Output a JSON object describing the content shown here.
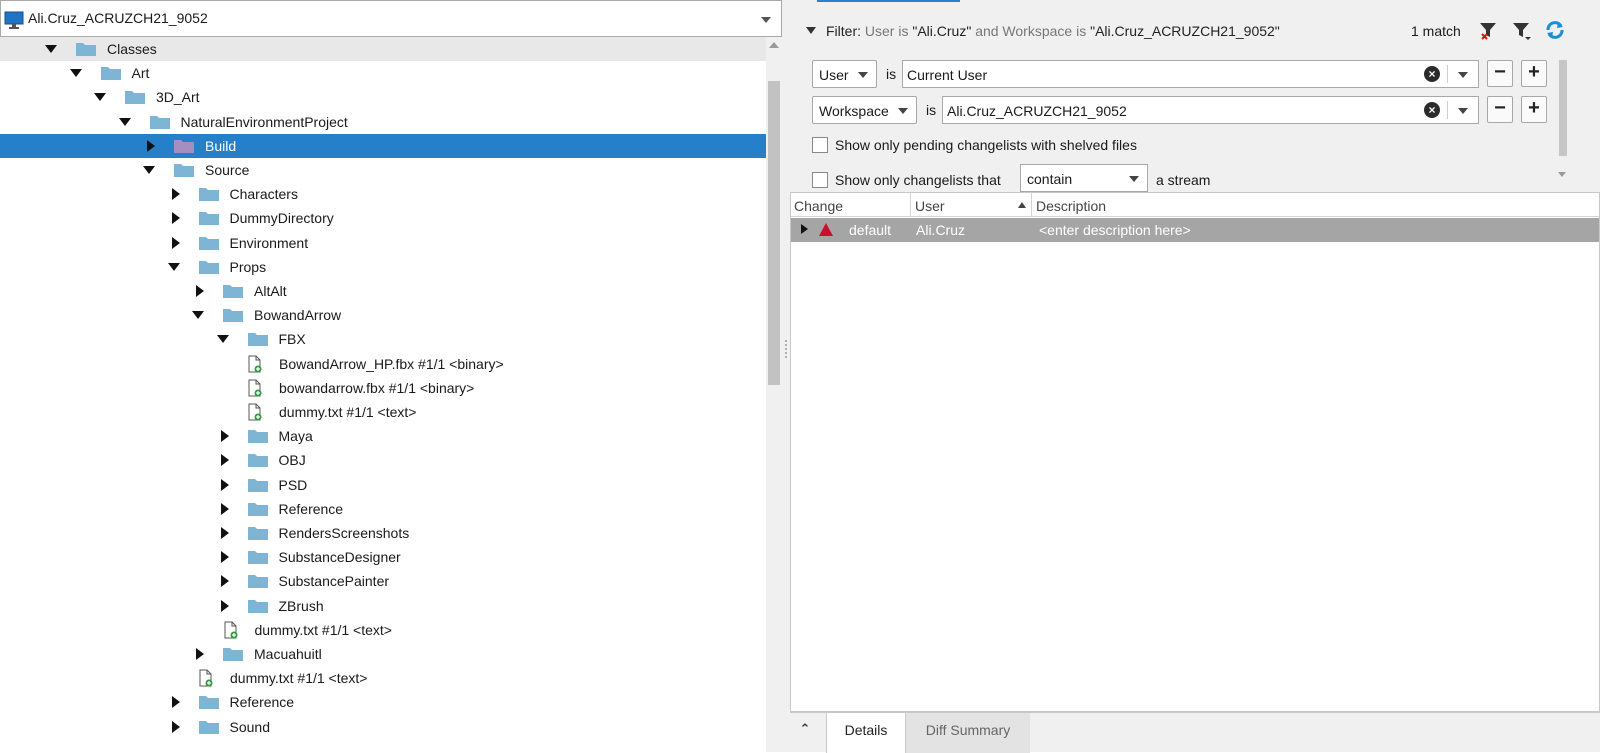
{
  "workspace_selector": {
    "label": "Ali.Cruz_ACRUZCH21_9052"
  },
  "tree": {
    "rows": [
      {
        "label": "Classes",
        "type": "folder",
        "state": "open"
      },
      {
        "label": "Art",
        "type": "folder",
        "state": "open"
      },
      {
        "label": "3D_Art",
        "type": "folder",
        "state": "open"
      },
      {
        "label": "NaturalEnvironmentProject",
        "type": "folder",
        "state": "open"
      },
      {
        "label": "Build",
        "type": "folder",
        "state": "closed",
        "selected": true
      },
      {
        "label": "Source",
        "type": "folder",
        "state": "open"
      },
      {
        "label": "Characters",
        "type": "folder",
        "state": "closed"
      },
      {
        "label": "DummyDirectory",
        "type": "folder",
        "state": "closed"
      },
      {
        "label": "Environment",
        "type": "folder",
        "state": "closed"
      },
      {
        "label": "Props",
        "type": "folder",
        "state": "open"
      },
      {
        "label": "AltAlt",
        "type": "folder",
        "state": "closed"
      },
      {
        "label": "BowandArrow",
        "type": "folder",
        "state": "open"
      },
      {
        "label": "FBX",
        "type": "folder",
        "state": "open"
      },
      {
        "label": "BowandArrow_HP.fbx #1/1 <binary>",
        "type": "file"
      },
      {
        "label": "bowandarrow.fbx #1/1 <binary>",
        "type": "file"
      },
      {
        "label": "dummy.txt #1/1 <text>",
        "type": "file"
      },
      {
        "label": "Maya",
        "type": "folder",
        "state": "closed"
      },
      {
        "label": "OBJ",
        "type": "folder",
        "state": "closed"
      },
      {
        "label": "PSD",
        "type": "folder",
        "state": "closed"
      },
      {
        "label": "Reference",
        "type": "folder",
        "state": "closed"
      },
      {
        "label": "RendersScreenshots",
        "type": "folder",
        "state": "closed"
      },
      {
        "label": "SubstanceDesigner",
        "type": "folder",
        "state": "closed"
      },
      {
        "label": "SubstancePainter",
        "type": "folder",
        "state": "closed"
      },
      {
        "label": "ZBrush",
        "type": "folder",
        "state": "closed"
      },
      {
        "label": "dummy.txt #1/1 <text>",
        "type": "file"
      },
      {
        "label": "Macuahuitl",
        "type": "folder",
        "state": "closed"
      },
      {
        "label": "dummy.txt #1/1 <text>",
        "type": "file"
      },
      {
        "label": "Reference",
        "type": "folder",
        "state": "closed"
      },
      {
        "label": "Sound",
        "type": "folder",
        "state": "closed"
      }
    ]
  },
  "filter": {
    "prefix": "Filter:",
    "text_a": "User is",
    "val_a": "\"Ali.Cruz\"",
    "text_b": "and Workspace is",
    "val_b": "\"Ali.Cruz_ACRUZCH21_9052\"",
    "match_count": "1 match",
    "rows": [
      {
        "field": "User",
        "op": "is",
        "value": "Current User"
      },
      {
        "field": "Workspace",
        "op": "is",
        "value": "Ali.Cruz_ACRUZCH21_9052"
      }
    ],
    "checkbox_shelved": "Show only pending changelists with shelved files",
    "checkbox_stream": "Show only changelists that",
    "stream_mode": "contain",
    "stream_suffix": "a stream"
  },
  "table": {
    "columns": [
      "Change",
      "User",
      "Description"
    ],
    "rows": [
      {
        "change": "default",
        "user": "Ali.Cruz",
        "description": "<enter description here>"
      }
    ]
  },
  "bottom_tabs": [
    "Details",
    "Diff Summary"
  ],
  "colors": {
    "selection": "#2680c9",
    "folder": "#7fb5d4",
    "build_folder": "#a48fc0",
    "row_highlight": "#a5a5a5",
    "warning": "#c8102e"
  }
}
